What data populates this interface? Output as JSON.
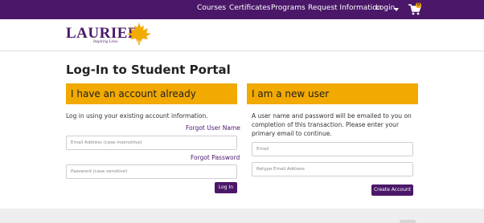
{
  "nav": {
    "items": [
      "Courses",
      "Certificates",
      "Programs",
      "Request Information",
      "Login"
    ],
    "cart_count": "0"
  },
  "logo": {
    "name": "LAURIER",
    "tagline": "Inspiring Lives."
  },
  "page": {
    "title": "Log-In to Student Portal"
  },
  "existing": {
    "heading": "I have an account already",
    "intro": "Log in using your existing account information.",
    "forgot_user": "Forgot User Name",
    "email_placeholder": "Email Address (case insensitive)",
    "forgot_password": "Forgot Password",
    "password_placeholder": "Password (case sensitive)",
    "login_button": "Log In"
  },
  "new_user": {
    "heading": "I am a new user",
    "intro": "A user name and password will be emailed to you on completion of this transaction. Please enter your primary email to continue.",
    "email_placeholder": "Email",
    "retype_placeholder": "Retype Email Address",
    "create_button": "Create Account"
  },
  "colors": {
    "brand_purple": "#4b1869",
    "accent_gold": "#f2a900"
  }
}
